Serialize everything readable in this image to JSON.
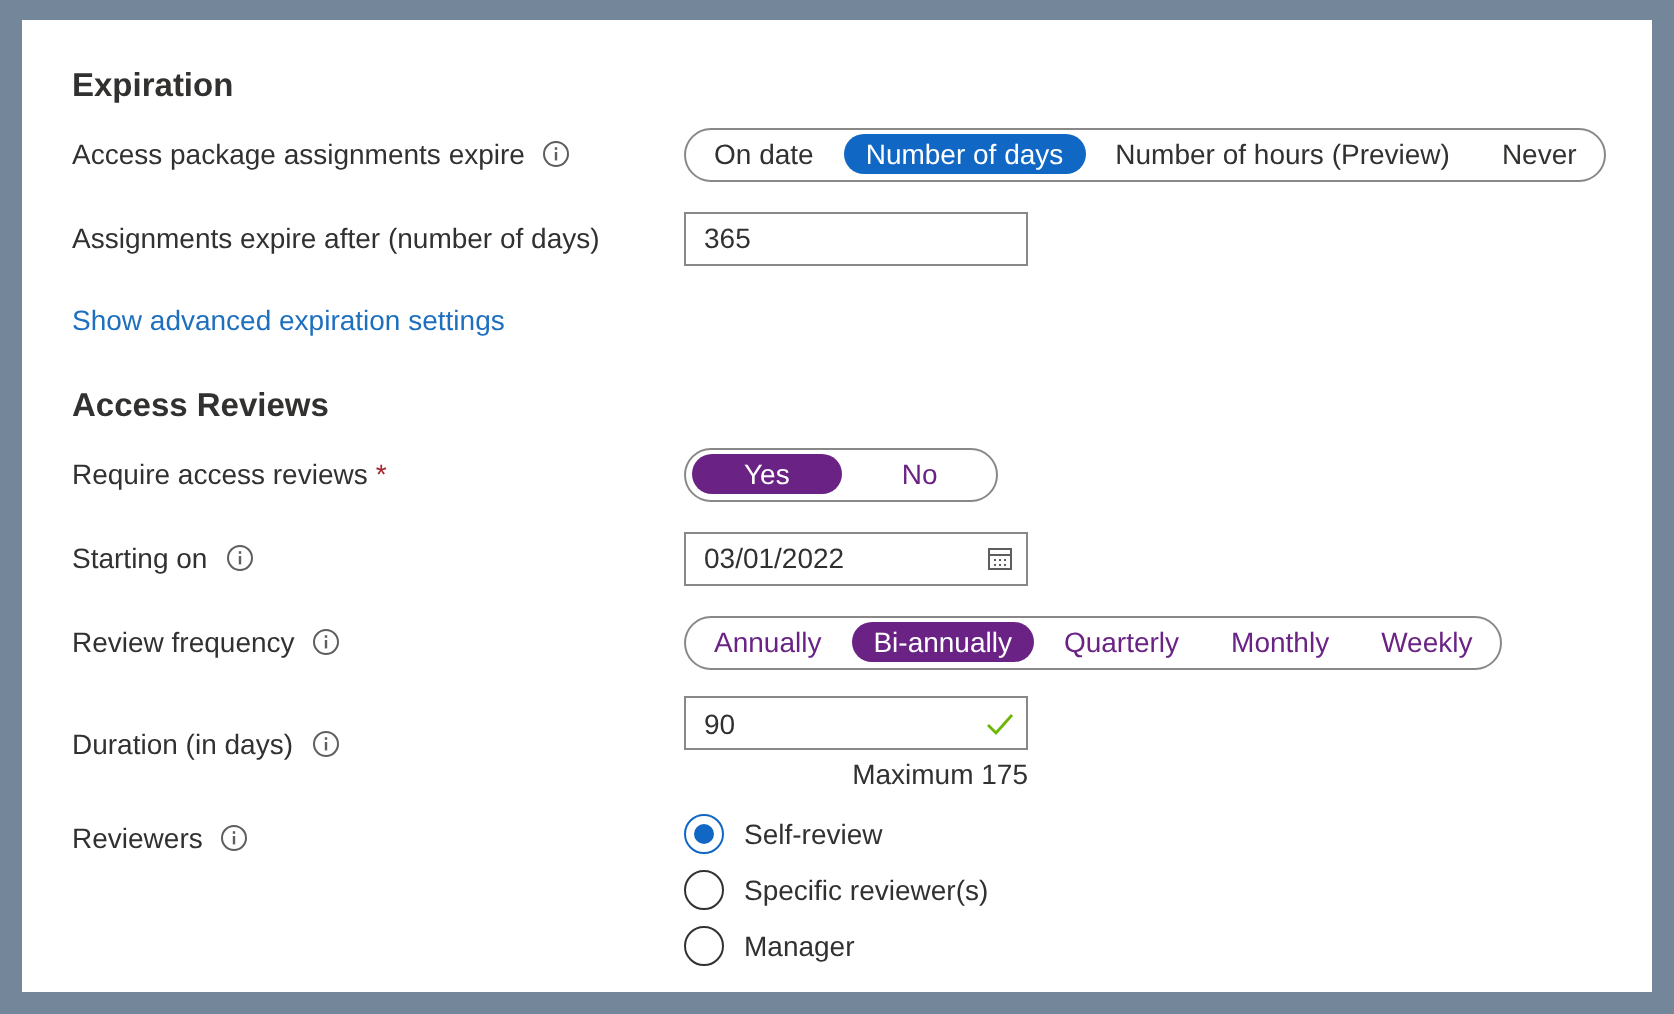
{
  "sections": [
    {
      "heading": "Expiration",
      "rows": [
        {
          "kind": "choice",
          "label": "Access package assignments expire",
          "info": true,
          "options": [
            {
              "label": "On date",
              "selected": false
            },
            {
              "label": "Number of days",
              "selected": true
            },
            {
              "label": "Number of hours (Preview)",
              "selected": false
            },
            {
              "label": "Never",
              "selected": false
            }
          ]
        },
        {
          "kind": "text",
          "label": "Assignments expire after (number of days)",
          "info": false,
          "value": "365"
        },
        {
          "kind": "link",
          "text": "Show advanced expiration settings"
        }
      ]
    },
    {
      "heading": "Access Reviews",
      "rows": [
        {
          "kind": "choice",
          "label": "Require access reviews",
          "required_mark": "*",
          "info": false,
          "options": [
            {
              "label": "Yes",
              "selected": true
            },
            {
              "label": "No",
              "selected": false
            }
          ]
        },
        {
          "kind": "date",
          "label": "Starting on",
          "info": true,
          "value": "03/01/2022"
        },
        {
          "kind": "choice",
          "label": "Review frequency",
          "info": true,
          "options": [
            {
              "label": "Annually",
              "selected": false
            },
            {
              "label": "Bi-annually",
              "selected": true
            },
            {
              "label": "Quarterly",
              "selected": false
            },
            {
              "label": "Monthly",
              "selected": false
            },
            {
              "label": "Weekly",
              "selected": false
            }
          ]
        },
        {
          "kind": "text",
          "label": "Duration (in days)",
          "info": true,
          "value": "90",
          "valid": true,
          "hint": "Maximum 175"
        },
        {
          "kind": "radio",
          "label": "Reviewers",
          "info": true,
          "options": [
            {
              "label": "Self-review",
              "selected": true
            },
            {
              "label": "Specific reviewer(s)",
              "selected": false
            },
            {
              "label": "Manager",
              "selected": false
            }
          ]
        }
      ]
    }
  ]
}
